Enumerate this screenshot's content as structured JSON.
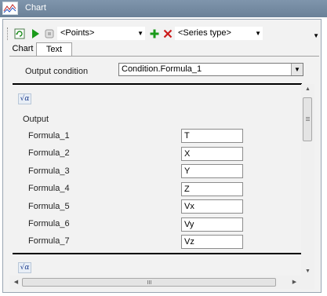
{
  "window": {
    "title": "Chart"
  },
  "toolbar": {
    "points_combo": "<Points>",
    "series_type_combo": "<Series type>"
  },
  "tabs": [
    {
      "label": "Chart",
      "active": false
    },
    {
      "label": "Text",
      "active": true
    }
  ],
  "output_condition": {
    "label": "Output condition",
    "value": "Condition.Formula_1"
  },
  "output": {
    "heading": "Output",
    "formulas": [
      {
        "label": "Formula_1",
        "value": "T"
      },
      {
        "label": "Formula_2",
        "value": "X"
      },
      {
        "label": "Formula_3",
        "value": "Y"
      },
      {
        "label": "Formula_4",
        "value": "Z"
      },
      {
        "label": "Formula_5",
        "value": "Vx"
      },
      {
        "label": "Formula_6",
        "value": "Vy"
      },
      {
        "label": "Formula_7",
        "value": "Vz"
      }
    ]
  },
  "colors": {
    "titlebar": "#7388a0",
    "play_green": "#1a9a1a",
    "add_green": "#1a9a1a",
    "delete_red": "#cc1a1a"
  },
  "icons": {
    "app": "chart-icon",
    "refresh": "refresh-icon",
    "play": "play-icon",
    "stop": "stop-icon",
    "add": "add-icon",
    "delete": "delete-icon",
    "formula": "formula-icon"
  }
}
